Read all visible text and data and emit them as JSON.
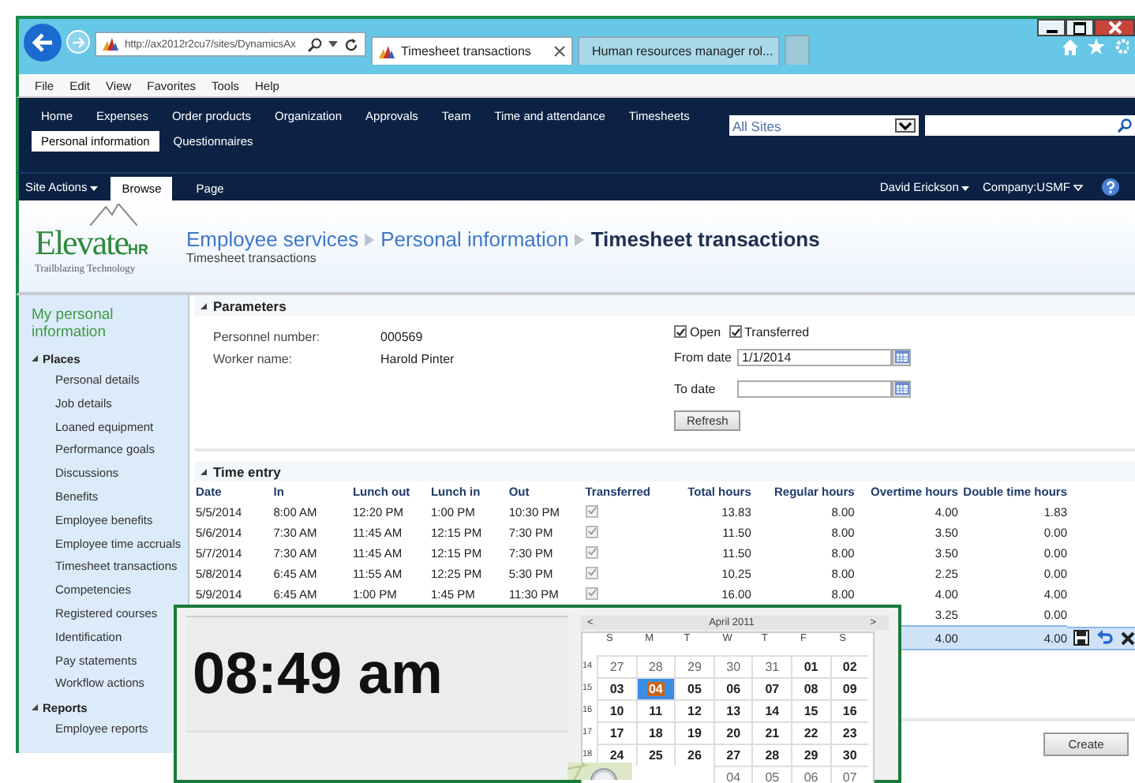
{
  "browser": {
    "address": "http://ax2012r2cu7/sites/DynamicsAx",
    "tabs": [
      {
        "title": "Timesheet transactions",
        "selected": true
      },
      {
        "title": "Human resources manager rol...",
        "selected": false
      }
    ],
    "menu": [
      "File",
      "Edit",
      "View",
      "Favorites",
      "Tools",
      "Help"
    ]
  },
  "nav": {
    "items": [
      {
        "label": "Home",
        "selected": false
      },
      {
        "label": "Expenses",
        "selected": false
      },
      {
        "label": "Order products",
        "selected": false
      },
      {
        "label": "Organization",
        "selected": false
      },
      {
        "label": "Approvals",
        "selected": false
      },
      {
        "label": "Team",
        "selected": false
      },
      {
        "label": "Time and attendance",
        "selected": false
      },
      {
        "label": "Timesheets",
        "selected": false
      },
      {
        "label": "Personal information",
        "selected": true
      },
      {
        "label": "Questionnaires",
        "selected": false
      }
    ],
    "search_scope": "All Sites"
  },
  "ribbon": {
    "site_actions": "Site Actions",
    "tabs": [
      {
        "label": "Browse",
        "selected": true
      },
      {
        "label": "Page",
        "selected": false
      }
    ],
    "user": "David Erickson",
    "company": "Company:USMF"
  },
  "header": {
    "logo": {
      "name": "Elevate",
      "suffix": "HR",
      "tagline": "Trailblazing Technology"
    },
    "breadcrumb": [
      "Employee services",
      "Personal information",
      "Timesheet transactions"
    ],
    "subtitle": "Timesheet transactions"
  },
  "sidebar": {
    "heading": "My personal information",
    "sections": [
      {
        "title": "Places",
        "expanded": true,
        "items": [
          "Personal details",
          "Job details",
          "Loaned equipment",
          "Performance goals",
          "Discussions",
          "Benefits",
          "Employee benefits",
          "Employee time accruals",
          "Timesheet transactions",
          "Competencies",
          "Registered courses",
          "Identification",
          "Pay statements",
          "Workflow actions"
        ]
      },
      {
        "title": "Reports",
        "expanded": true,
        "items": [
          "Employee reports"
        ]
      }
    ]
  },
  "parameters": {
    "title": "Parameters",
    "expanded": true,
    "personnel_number_label": "Personnel number:",
    "personnel_number": "000569",
    "worker_name_label": "Worker name:",
    "worker_name": "Harold Pinter",
    "filters": [
      {
        "label": "Open",
        "checked": true
      },
      {
        "label": "Transferred",
        "checked": true
      }
    ],
    "from_date_label": "From date",
    "from_date": "1/1/2014",
    "to_date_label": "To date",
    "refresh": "Refresh"
  },
  "time_entry": {
    "title": "Time entry",
    "expanded": true,
    "columns": [
      "Date",
      "In",
      "Lunch out",
      "Lunch in",
      "Out",
      "Transferred",
      "Total hours",
      "Regular hours",
      "Overtime hours",
      "Double time hours"
    ],
    "rows": [
      {
        "date": "5/5/2014",
        "in": "8:00 AM",
        "lunch_out": "12:20 PM",
        "lunch_in": "1:00 PM",
        "out": "10:30 PM",
        "transferred": true,
        "total_hours": "13.83",
        "regular_hours": "8.00",
        "overtime_hours": "4.00",
        "double_time_hours": "1.83",
        "selected": false
      },
      {
        "date": "5/6/2014",
        "in": "7:30 AM",
        "lunch_out": "11:45 AM",
        "lunch_in": "12:15 PM",
        "out": "7:30 PM",
        "transferred": true,
        "total_hours": "11.50",
        "regular_hours": "8.00",
        "overtime_hours": "3.50",
        "double_time_hours": "0.00",
        "selected": false
      },
      {
        "date": "5/7/2014",
        "in": "7:30 AM",
        "lunch_out": "11:45 AM",
        "lunch_in": "12:15 PM",
        "out": "7:30 PM",
        "transferred": true,
        "total_hours": "11.50",
        "regular_hours": "8.00",
        "overtime_hours": "3.50",
        "double_time_hours": "0.00",
        "selected": false
      },
      {
        "date": "5/8/2014",
        "in": "6:45 AM",
        "lunch_out": "11:55 AM",
        "lunch_in": "12:25 PM",
        "out": "5:30 PM",
        "transferred": true,
        "total_hours": "10.25",
        "regular_hours": "8.00",
        "overtime_hours": "2.25",
        "double_time_hours": "0.00",
        "selected": false
      },
      {
        "date": "5/9/2014",
        "in": "6:45 AM",
        "lunch_out": "1:00 PM",
        "lunch_in": "1:45 PM",
        "out": "11:30 PM",
        "transferred": true,
        "total_hours": "16.00",
        "regular_hours": "8.00",
        "overtime_hours": "4.00",
        "double_time_hours": "4.00",
        "selected": false
      },
      {
        "overtime_hours": "3.25",
        "double_time_hours": "0.00",
        "selected": false
      },
      {
        "overtime_hours": "4.00",
        "double_time_hours": "4.00",
        "selected": true
      }
    ]
  },
  "create_button": "Create",
  "clock_window": {
    "time": "08:49 am",
    "calendar": {
      "previous": "<",
      "month": "April 2011",
      "next": ">",
      "weekdays": [
        "S",
        "M",
        "T",
        "W",
        "T",
        "F",
        "S"
      ],
      "weeks": [
        {
          "number": "14",
          "days": [
            {
              "day": "27",
              "other_month": true,
              "selected": false
            },
            {
              "day": "28",
              "other_month": true,
              "selected": false
            },
            {
              "day": "29",
              "other_month": true,
              "selected": false
            },
            {
              "day": "30",
              "other_month": true,
              "selected": false
            },
            {
              "day": "31",
              "other_month": true,
              "selected": false
            },
            {
              "day": "01",
              "other_month": false,
              "selected": false
            },
            {
              "day": "02",
              "other_month": false,
              "selected": false
            }
          ]
        },
        {
          "number": "15",
          "days": [
            {
              "day": "03",
              "other_month": false,
              "selected": false
            },
            {
              "day": "04",
              "other_month": false,
              "selected": true
            },
            {
              "day": "05",
              "other_month": false,
              "selected": false
            },
            {
              "day": "06",
              "other_month": false,
              "selected": false
            },
            {
              "day": "07",
              "other_month": false,
              "selected": false
            },
            {
              "day": "08",
              "other_month": false,
              "selected": false
            },
            {
              "day": "09",
              "other_month": false,
              "selected": false
            }
          ]
        },
        {
          "number": "16",
          "days": [
            {
              "day": "10",
              "other_month": false,
              "selected": false
            },
            {
              "day": "11",
              "other_month": false,
              "selected": false
            },
            {
              "day": "12",
              "other_month": false,
              "selected": false
            },
            {
              "day": "13",
              "other_month": false,
              "selected": false
            },
            {
              "day": "14",
              "other_month": false,
              "selected": false
            },
            {
              "day": "15",
              "other_month": false,
              "selected": false
            },
            {
              "day": "16",
              "other_month": false,
              "selected": false
            }
          ]
        },
        {
          "number": "17",
          "days": [
            {
              "day": "17",
              "other_month": false,
              "selected": false
            },
            {
              "day": "18",
              "other_month": false,
              "selected": false
            },
            {
              "day": "19",
              "other_month": false,
              "selected": false
            },
            {
              "day": "20",
              "other_month": false,
              "selected": false
            },
            {
              "day": "21",
              "other_month": false,
              "selected": false
            },
            {
              "day": "22",
              "other_month": false,
              "selected": false
            },
            {
              "day": "23",
              "other_month": false,
              "selected": false
            }
          ]
        },
        {
          "number": "18",
          "days": [
            {
              "day": "24",
              "other_month": false,
              "selected": false
            },
            {
              "day": "25",
              "other_month": false,
              "selected": false
            },
            {
              "day": "26",
              "other_month": false,
              "selected": false
            },
            {
              "day": "27",
              "other_month": false,
              "selected": false
            },
            {
              "day": "28",
              "other_month": false,
              "selected": false
            },
            {
              "day": "29",
              "other_month": false,
              "selected": false
            },
            {
              "day": "30",
              "other_month": false,
              "selected": false
            }
          ]
        },
        {
          "days": [
            {
              "day": "04",
              "other_month": true,
              "selected": false
            },
            {
              "day": "05",
              "other_month": true,
              "selected": false
            },
            {
              "day": "06",
              "other_month": true,
              "selected": false
            },
            {
              "day": "07",
              "other_month": true,
              "selected": false
            }
          ]
        }
      ]
    }
  }
}
